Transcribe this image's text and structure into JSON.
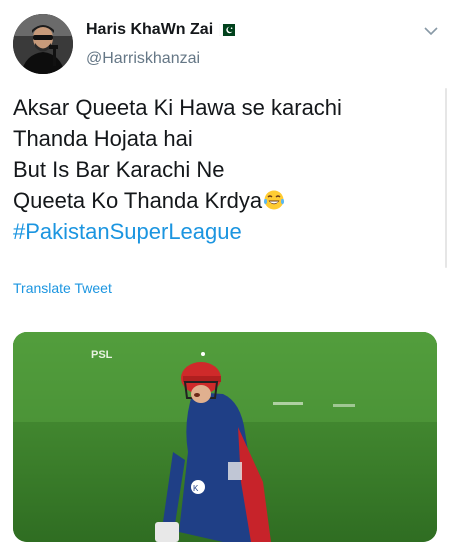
{
  "tweet": {
    "display_name": "Haris KhaWn Zai",
    "handle": "@Harriskhanzai",
    "text_lines": [
      "Aksar Queeta Ki Hawa se karachi",
      "Thanda Hojata hai",
      "But Is Bar Karachi Ne",
      "Queeta Ko Thanda Krdya"
    ],
    "hashtag": "#PakistanSuperLeague",
    "translate_label": "Translate Tweet",
    "emoji": "laughing-tears-emoji",
    "flag": "pakistan-flag-icon"
  },
  "media": {
    "description_icon": "cricket-player-photo",
    "watermark": "PSL",
    "colors": {
      "pitch": "#3f8a2e",
      "jersey": "#1f3f86",
      "helmet": "#d42b2b"
    }
  },
  "colors": {
    "link": "#1b95e0",
    "text": "#14171a",
    "muted": "#657786"
  }
}
